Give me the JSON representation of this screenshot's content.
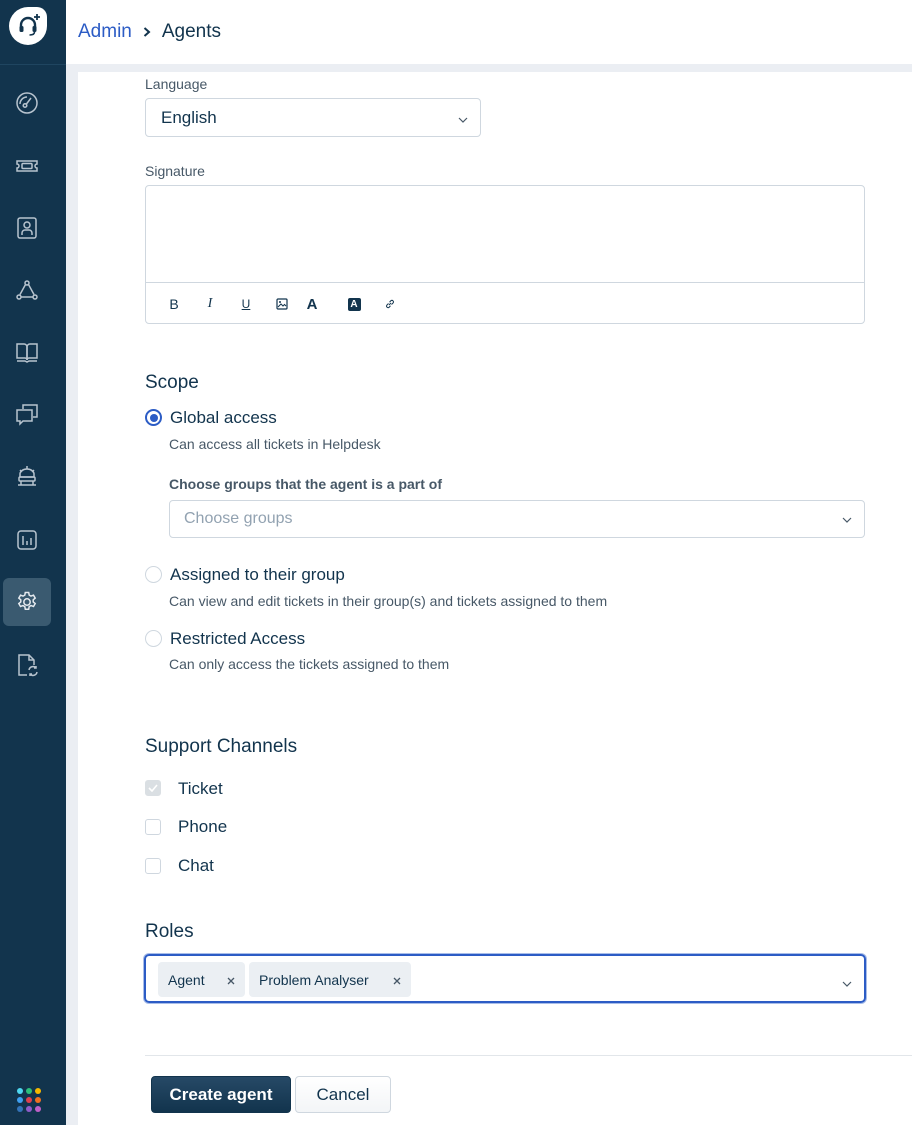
{
  "header": {
    "breadcrumb": [
      {
        "label": "Admin"
      },
      {
        "label": "Agents"
      }
    ]
  },
  "sidebar": {
    "items": [
      {
        "name": "dashboard",
        "icon": "gauge-icon",
        "active": false
      },
      {
        "name": "tickets",
        "icon": "ticket-icon",
        "active": false
      },
      {
        "name": "contacts",
        "icon": "contact-card-icon",
        "active": false
      },
      {
        "name": "groups",
        "icon": "network-icon",
        "active": false
      },
      {
        "name": "solutions",
        "icon": "book-icon",
        "active": false
      },
      {
        "name": "forums",
        "icon": "chat-bubbles-icon",
        "active": false
      },
      {
        "name": "bots",
        "icon": "robot-icon",
        "active": false
      },
      {
        "name": "analytics",
        "icon": "bar-chart-icon",
        "active": false
      },
      {
        "name": "admin",
        "icon": "gear-icon",
        "active": true
      },
      {
        "name": "updates",
        "icon": "file-sync-icon",
        "active": false
      }
    ],
    "apps_colors": [
      "#4fd8f0",
      "#2dbf7b",
      "#f5b800",
      "#3fa0f0",
      "#e0404d",
      "#f07020",
      "#3373b8",
      "#8f5cc8",
      "#c060c8"
    ]
  },
  "form": {
    "language": {
      "label": "Language",
      "value": "English"
    },
    "signature": {
      "label": "Signature",
      "value": "",
      "toolbar": [
        {
          "name": "bold",
          "glyph": "B"
        },
        {
          "name": "italic",
          "glyph": "I"
        },
        {
          "name": "underline",
          "glyph": "U"
        },
        {
          "name": "insert-image",
          "glyph": ""
        },
        {
          "name": "font-color",
          "glyph": "A"
        },
        {
          "name": "background-color",
          "glyph": "A"
        },
        {
          "name": "insert-link",
          "glyph": ""
        }
      ]
    },
    "scope": {
      "title": "Scope",
      "options": [
        {
          "label": "Global access",
          "description": "Can access all tickets in Helpdesk",
          "checked": true
        },
        {
          "label": "Assigned to their group",
          "description": "Can view and edit tickets in their group(s) and tickets assigned to them",
          "checked": false
        },
        {
          "label": "Restricted Access",
          "description": "Can only access the tickets assigned to them",
          "checked": false
        }
      ],
      "groups_label": "Choose groups that the agent is a part of",
      "groups_placeholder": "Choose groups"
    },
    "support_channels": {
      "title": "Support Channels",
      "channels": [
        {
          "label": "Ticket",
          "checked": true,
          "disabled": true
        },
        {
          "label": "Phone",
          "checked": false,
          "disabled": false
        },
        {
          "label": "Chat",
          "checked": false,
          "disabled": false
        }
      ]
    },
    "roles": {
      "title": "Roles",
      "selected": [
        {
          "label": "Agent"
        },
        {
          "label": "Problem Analyser"
        }
      ]
    }
  },
  "actions": {
    "create_label": "Create agent",
    "cancel_label": "Cancel"
  },
  "colors": {
    "sidebar_bg": "#12344d",
    "accent": "#2c5cc5",
    "text": "#12344d"
  }
}
